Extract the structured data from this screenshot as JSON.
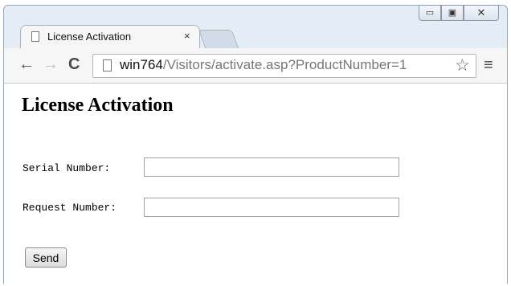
{
  "browser": {
    "tab_title": "License Activation",
    "tab_close": "×",
    "url_host": "win764",
    "url_path": "/Visitors/activate.asp?ProductNumber=1",
    "window_controls": {
      "minimize": "▭",
      "maximize": "▣",
      "close": "✕"
    },
    "nav": {
      "back": "←",
      "forward": "→",
      "reload": "C",
      "star": "☆",
      "menu": "≡"
    }
  },
  "page": {
    "heading": "License Activation",
    "form": {
      "serial_label": "Serial Number:",
      "serial_value": "",
      "request_label": "Request Number:",
      "request_value": "",
      "send_label": "Send"
    }
  }
}
